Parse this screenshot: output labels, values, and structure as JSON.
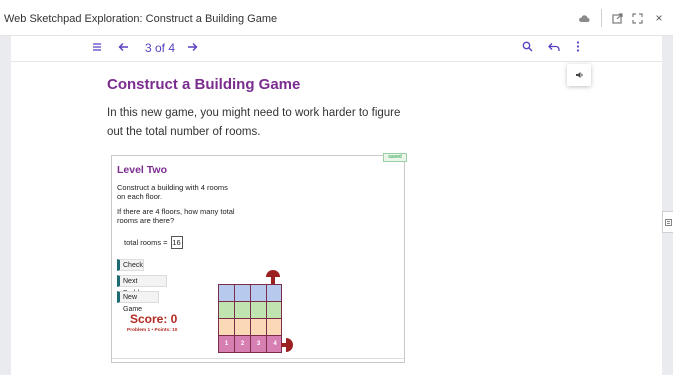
{
  "window": {
    "title": "Web Sketchpad Exploration: Construct a Building Game",
    "icons": [
      "cloud-icon",
      "external-link-icon",
      "expand-icon",
      "close-icon"
    ],
    "close_glyph": "×"
  },
  "toolbar": {
    "page_indicator": "3 of 4",
    "icons": [
      "menu-icon",
      "back-arrow-icon",
      "forward-arrow-icon",
      "search-icon",
      "undo-icon",
      "more-vertical-icon",
      "speaker-icon"
    ]
  },
  "content": {
    "heading": "Construct a Building Game",
    "intro": "In this new game, you might need to work harder to figure out the total number of rooms."
  },
  "sketch": {
    "saved_label": "saved",
    "level_title": "Level Two",
    "prompt1": "Construct a building with 4 rooms on each floor.",
    "prompt2": "If there are 4 floors, how many total rooms are there?",
    "total_label": "total rooms =",
    "total_value": "16",
    "buttons": {
      "check": "Check",
      "next_problem": "Next Problem",
      "new_game": "New Game"
    },
    "score": "Score: 0",
    "score_detail": "Problem 1 • Points: 10",
    "building": {
      "floors": 4,
      "rooms_per_floor": 4,
      "floor_colors": [
        "#b7c9ec",
        "#bfe4b0",
        "#fbd9b6",
        "#d77fb3"
      ],
      "room_labels": [
        "1",
        "2",
        "3",
        "4"
      ]
    }
  }
}
